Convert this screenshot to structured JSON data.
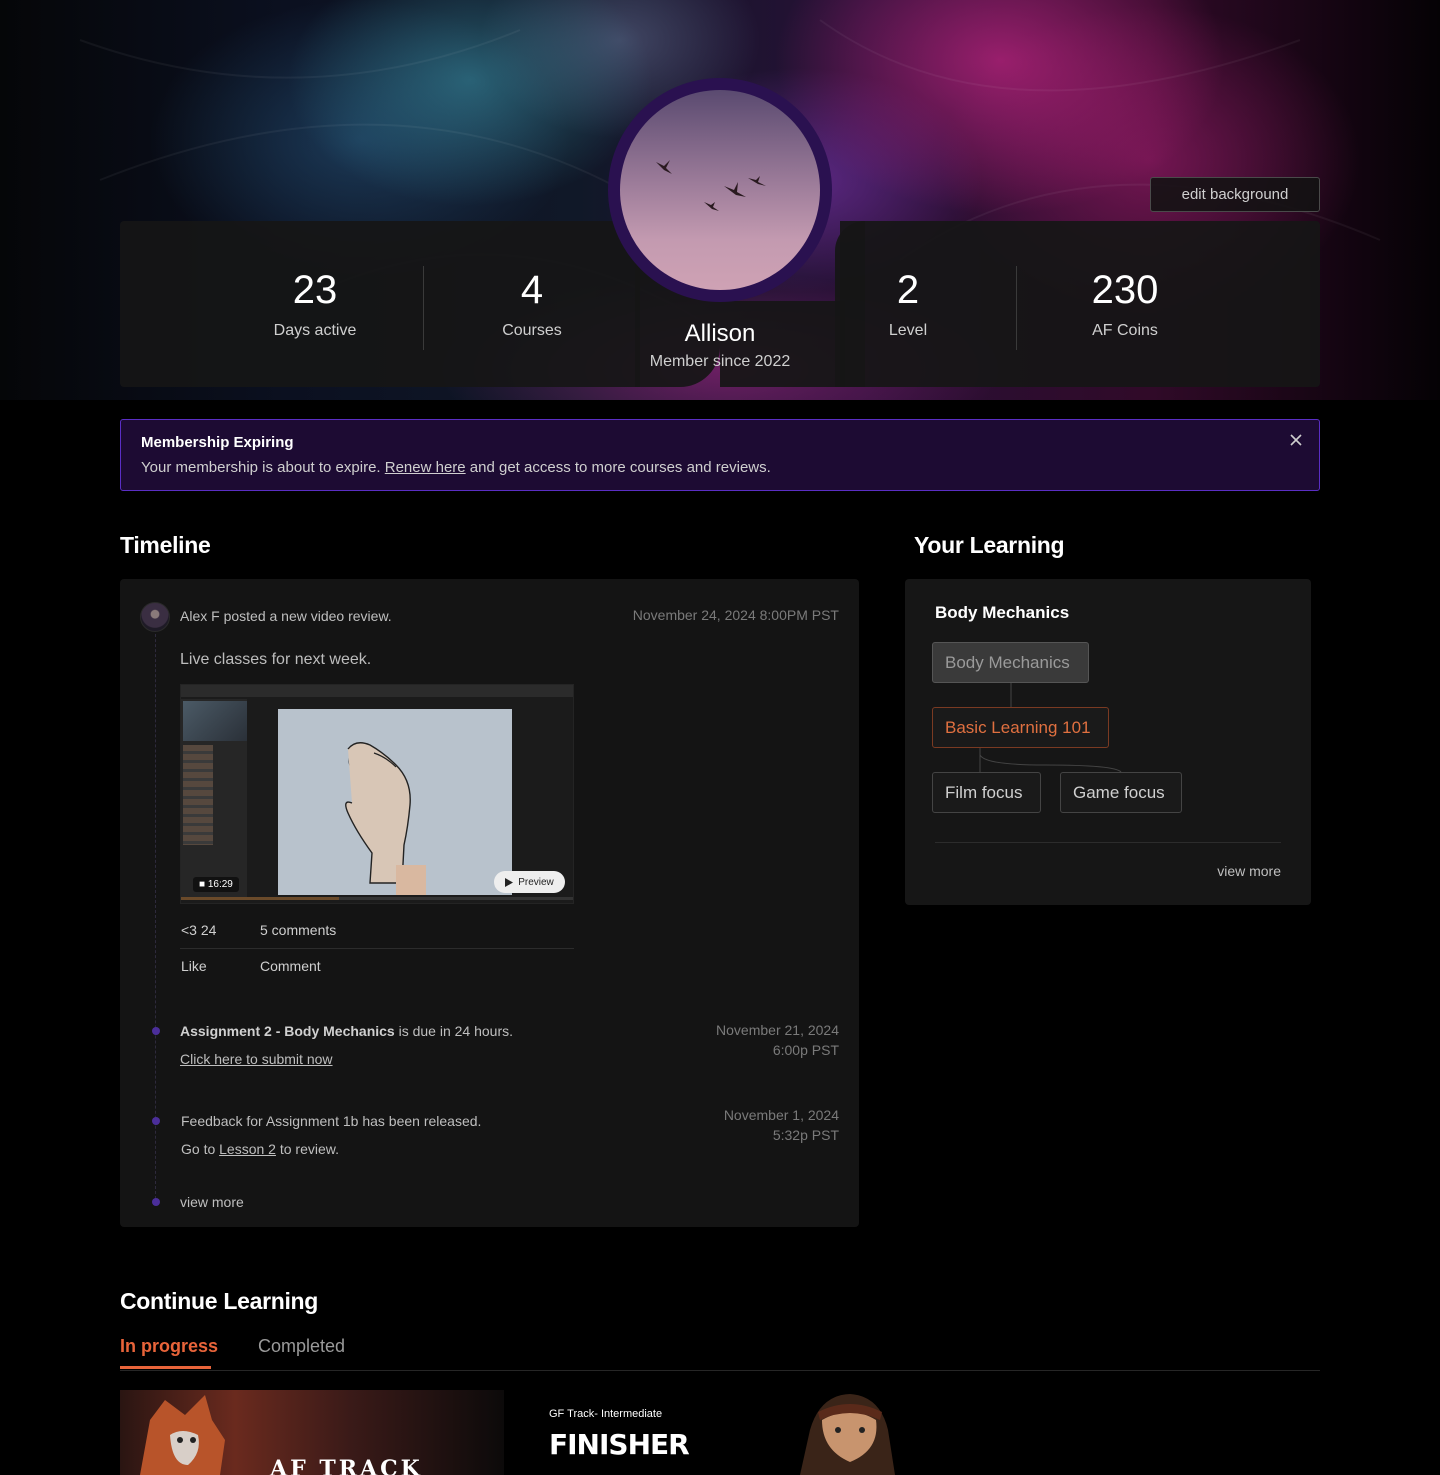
{
  "profile": {
    "edit_background_label": "edit background",
    "name": "Allison",
    "member_since": "Member since 2022",
    "stats": [
      {
        "value": "23",
        "label": "Days active"
      },
      {
        "value": "4",
        "label": "Courses"
      },
      {
        "value": "2",
        "label": "Level"
      },
      {
        "value": "230",
        "label": "AF Coins"
      }
    ]
  },
  "alert": {
    "title": "Membership Expiring",
    "body_before": "Your membership is about to expire. ",
    "link": "Renew here",
    "body_after": " and get access to more courses and reviews.",
    "close_icon": "close-icon"
  },
  "timeline": {
    "heading": "Timeline",
    "post": {
      "author_line": "Alex F posted a new video review.",
      "date": "November 24, 2024 8:00PM PST",
      "title": "Live classes for next week.",
      "video_duration": "16:29",
      "preview_label": "Preview",
      "progress": 0.4,
      "likes": "<3 24",
      "comments": "5 comments",
      "like_label": "Like",
      "comment_label": "Comment"
    },
    "assignment": {
      "bold": "Assignment 2 - Body Mechanics",
      "rest": " is due in 24 hours.",
      "link": "Click here to submit now",
      "date_line1": "November 21, 2024",
      "date_line2": "6:00p PST"
    },
    "feedback": {
      "line1": "Feedback for Assignment 1b has been released.",
      "line2_before": "Go to ",
      "line2_link": "Lesson 2",
      "line2_after": " to review.",
      "date_line1": "November 1, 2024",
      "date_line2": "5:32p PST"
    },
    "view_more": "view more"
  },
  "learning": {
    "heading": "Your Learning",
    "card_title": "Body Mechanics",
    "nodes": {
      "root": "Body Mechanics",
      "basic": "Basic Learning 101",
      "film": "Film focus",
      "game": "Game focus"
    },
    "view_more": "view more",
    "colors": {
      "accent": "#e8643a"
    }
  },
  "continue_learning": {
    "heading": "Continue Learning",
    "tabs": {
      "active": "In progress",
      "inactive": "Completed"
    },
    "cards": [
      {
        "title": "AF TRACK"
      },
      {
        "subtitle": "GF Track- Intermediate",
        "title": "FINISHER"
      }
    ]
  }
}
